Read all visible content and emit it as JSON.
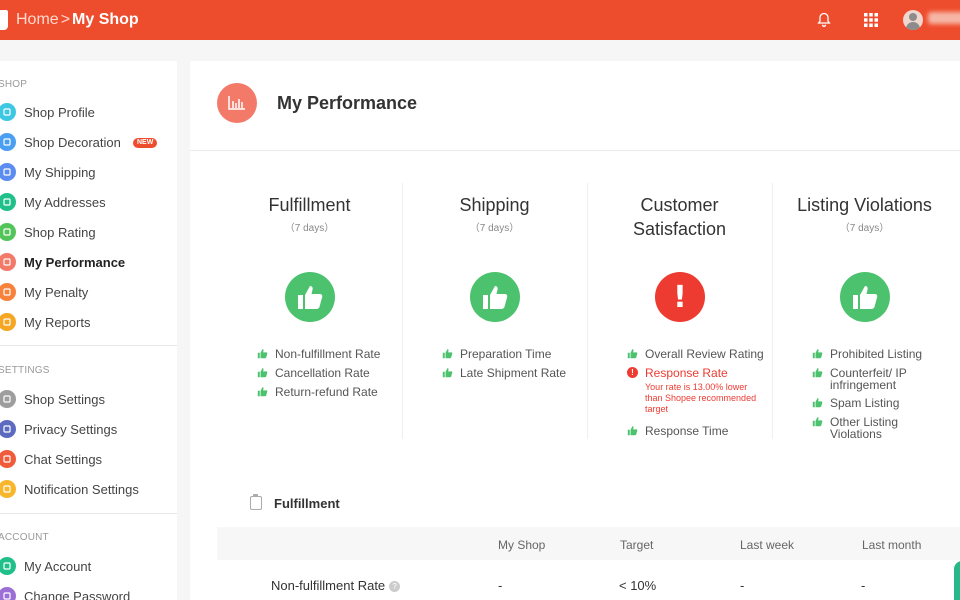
{
  "colors": {
    "brand": "#ee4d2d",
    "good": "#4cc26e",
    "bad": "#ee3b32"
  },
  "breadcrumb": {
    "home": "Home",
    "separator": ">",
    "current": "My Shop"
  },
  "topbar": {
    "icons": [
      "bell-icon",
      "apps-grid-icon",
      "user-avatar-icon"
    ]
  },
  "sidebar": {
    "shop_title": "SHOP",
    "shop_items": [
      {
        "label": "Shop Profile",
        "icon": "shop-profile-icon",
        "color": "#3ec7e3"
      },
      {
        "label": "Shop Decoration",
        "icon": "shop-decoration-icon",
        "color": "#4a9ff2",
        "badge": "NEW"
      },
      {
        "label": "My Shipping",
        "icon": "shipping-truck-icon",
        "color": "#5b8cf0"
      },
      {
        "label": "My Addresses",
        "icon": "location-pin-icon",
        "color": "#21c08b"
      },
      {
        "label": "Shop Rating",
        "icon": "star-icon",
        "color": "#52c45a"
      },
      {
        "label": "My Performance",
        "icon": "performance-chart-icon",
        "color": "#f37a68",
        "active": true
      },
      {
        "label": "My Penalty",
        "icon": "penalty-bolt-icon",
        "color": "#f7823c"
      },
      {
        "label": "My Reports",
        "icon": "reports-icon",
        "color": "#f5a623"
      }
    ],
    "settings_title": "SETTINGS",
    "settings_items": [
      {
        "label": "Shop Settings",
        "icon": "gear-icon",
        "color": "#9e9e9e"
      },
      {
        "label": "Privacy Settings",
        "icon": "lock-icon",
        "color": "#5c6bc0"
      },
      {
        "label": "Chat Settings",
        "icon": "chat-icon",
        "color": "#ef5b3b"
      },
      {
        "label": "Notification Settings",
        "icon": "notification-icon",
        "color": "#f8b62d"
      }
    ],
    "account_title": "ACCOUNT",
    "account_items": [
      {
        "label": "My Account",
        "icon": "account-card-icon",
        "color": "#21c08b"
      },
      {
        "label": "Change Password",
        "icon": "password-icon",
        "color": "#9b6fd6"
      }
    ]
  },
  "main": {
    "title": "My Performance",
    "columns": [
      {
        "title": "Fulfillment",
        "subtitle": "（7 days）",
        "status": "good",
        "metrics": [
          {
            "label": "Non-fulfillment Rate",
            "status": "good"
          },
          {
            "label": "Cancellation Rate",
            "status": "good"
          },
          {
            "label": "Return-refund Rate",
            "status": "good"
          }
        ]
      },
      {
        "title": "Shipping",
        "subtitle": "（7 days）",
        "status": "good",
        "metrics": [
          {
            "label": "Preparation Time",
            "status": "good"
          },
          {
            "label": "Late Shipment Rate",
            "status": "good"
          }
        ]
      },
      {
        "title_line1": "Customer",
        "title_line2": "Satisfaction",
        "status": "bad",
        "status_symbol": "!",
        "metrics": [
          {
            "label": "Overall Review Rating",
            "status": "good"
          },
          {
            "label": "Response Rate",
            "status": "bad",
            "note": "Your rate is 13.00% lower than Shopee recommended target"
          },
          {
            "label": "Response Time",
            "status": "good"
          }
        ]
      },
      {
        "title": "Listing Violations",
        "subtitle": "（7 days）",
        "status": "good",
        "metrics": [
          {
            "label": "Prohibited Listing",
            "status": "good"
          },
          {
            "label": "Counterfeit/ IP infringement",
            "status": "good"
          },
          {
            "label": "Spam Listing",
            "status": "good"
          },
          {
            "label": "Other Listing Violations",
            "status": "good"
          }
        ]
      }
    ],
    "fulfillment_section": {
      "title": "Fulfillment",
      "headers": [
        "My Shop",
        "Target",
        "Last week",
        "Last month"
      ],
      "rows": [
        {
          "name": "Non-fulfillment Rate",
          "help": "?",
          "my_shop": "-",
          "target": "< 10%",
          "last_week": "-",
          "last_month": "-"
        }
      ]
    }
  }
}
